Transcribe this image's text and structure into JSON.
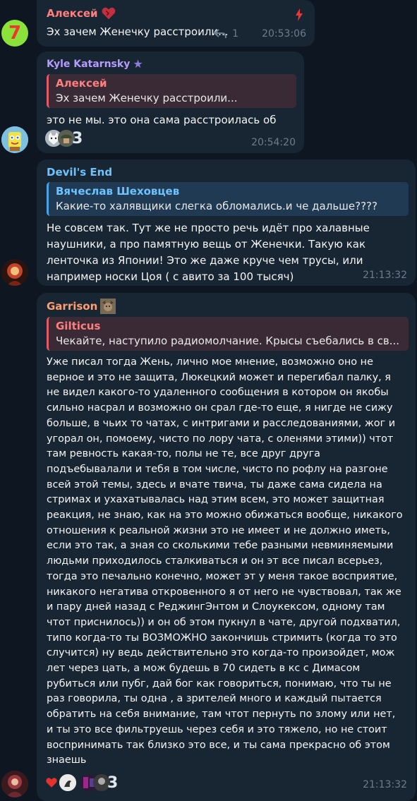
{
  "messages": [
    {
      "sender": "Алексей",
      "text": "Эх зачем Женечку расстроили...",
      "reply_count": "1",
      "time": "20:53:06",
      "avatar_label": "7"
    },
    {
      "sender": "Kyle Katarnsky",
      "quote_sender": "Алексей",
      "quote_text": "Эх зачем Женечку расстроили...",
      "text": "это не мы. это она сама расстроилась об нас",
      "reaction_count": "3",
      "time": "20:54:20"
    },
    {
      "sender": "Devil's End",
      "quote_sender": "Вячеслав Шеховцев",
      "quote_text": "Какие-то халявщики слегка обломались.и че дальше????",
      "text": "Не совсем так. Тут же не просто речь идёт про халавные наушники, а про памятную вещь от Женечки. Такую как ленточка из Японии! Это же даже круче чем трусы, или например носки Цоя ( с авито за 100 тысяч)",
      "time": "21:13:32"
    },
    {
      "sender": "Garrison",
      "quote_sender": "Gilticus",
      "quote_text": "Чекайте, наступило радиомолчание. Крысы съебались  в св...",
      "text": "Уже писал тогда Жень, лично мое мнение, возможно оно не верное и это не защита, Люкецкий может и перегибал палку, я не видел какого-то удаленного сообщения в котором он якобы сильно насрал и возможно он срал где-то еще, я нигде не сижу больше, в чьих то чатах, с интригами и расследованиями, жог и угорал он, помоему, чисто по лору чата, с оленями этими)) чтот там ревность какая-то, полы не те, все друг друга подъебывалали и тебя в том числе, чисто по рофлу на разгоне всей этой темы, здесь и вчате твича, ты даже сама сидела на стримах и ухахатывалась над этим всем, это может защитная реакция, не знаю, как на это можно обижаться вообще, никакого отношения к реальной жизни это не имеет и не должно иметь, если это так, а зная со сколькими тебе разными невминяемыми людьми приходилось сталкиваться и он эт все писал всерьез, тогда это печально конечно, может эт у меня такое восприятие, никакого негатива откровенного я от него не чувствовал, так же и пару дней назад с РеджингЭнтом и Слоукексом, одному там чтот приснилось)) и он об этом пукнул в чате, другой подхватил, типо когда-то ты ВОЗМОЖНО закончишь стримить (когда то это случится) ну ведь действительно это когда-то произойдет, мож лет через цать, а мож будешь в 70 сидеть в кс с Димасом рубиться или пубг, дай бог как говориться, понимаю, что ты не раз говорила, ты одна , а зрителей много и каждый пытается обратить на себя внимание, там чтот пернуть по злому или нет, и ты это все фильтруешь через себя и это тяжело, но не стоит воспринимать так близко это все, и ты сама прекрасно об этом знаешь",
      "reaction_count": "3",
      "time": "21:13:32"
    }
  ],
  "colors": {
    "bg": "#0e1621",
    "bubble": "#182533",
    "name_red": "#ff7f7f",
    "name_purple": "#b69cff",
    "name_blue": "#6ec3ff",
    "name_orange": "#ff9e6e",
    "time": "#6c7c8c"
  }
}
